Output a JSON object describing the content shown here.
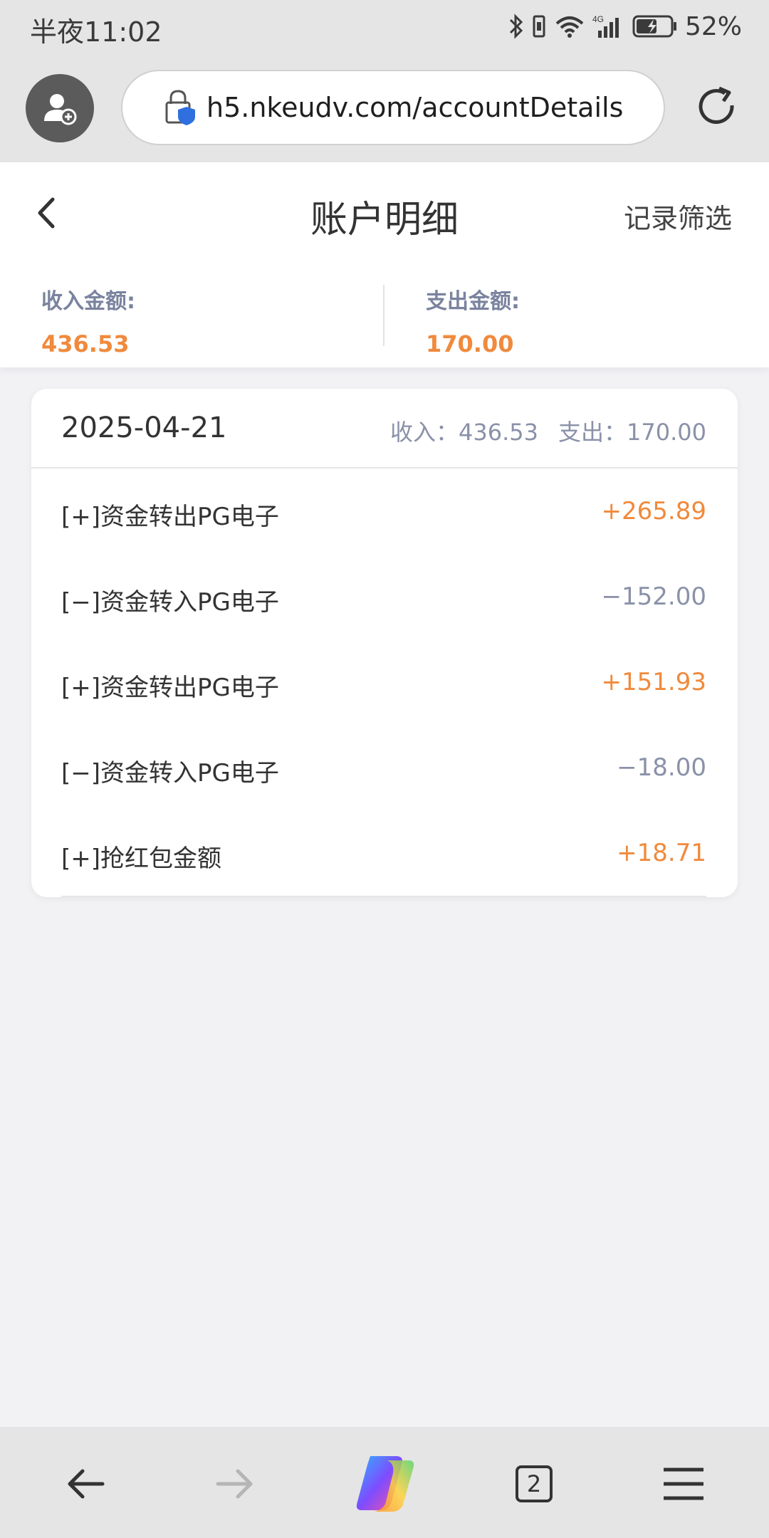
{
  "status_bar": {
    "time": "半夜11:02",
    "battery": "52%"
  },
  "browser": {
    "url": "h5.nkeudv.com/accountDetails",
    "tab_count": "2"
  },
  "header": {
    "title": "账户明细",
    "filter_label": "记录筛选"
  },
  "summary": {
    "income_label": "收入金额:",
    "income_value": "436.53",
    "expense_label": "支出金额:",
    "expense_value": "170.00"
  },
  "day": {
    "date": "2025-04-21",
    "income_text": "收入：436.53",
    "expense_text": "支出：170.00"
  },
  "records": [
    {
      "desc": "[+]资金转出PG电子",
      "amount": "+265.89",
      "sign": "plus"
    },
    {
      "desc": "[−]资金转入PG电子",
      "amount": "−152.00",
      "sign": "minus"
    },
    {
      "desc": "[+]资金转出PG电子",
      "amount": "+151.93",
      "sign": "plus"
    },
    {
      "desc": "[−]资金转入PG电子",
      "amount": "−18.00",
      "sign": "minus"
    },
    {
      "desc": "[+]抢红包金额",
      "amount": "+18.71",
      "sign": "plus"
    }
  ],
  "colors": {
    "accent_orange": "#f08a3c",
    "muted_gray": "#8a91a8",
    "label_blue_gray": "#7a839e"
  }
}
